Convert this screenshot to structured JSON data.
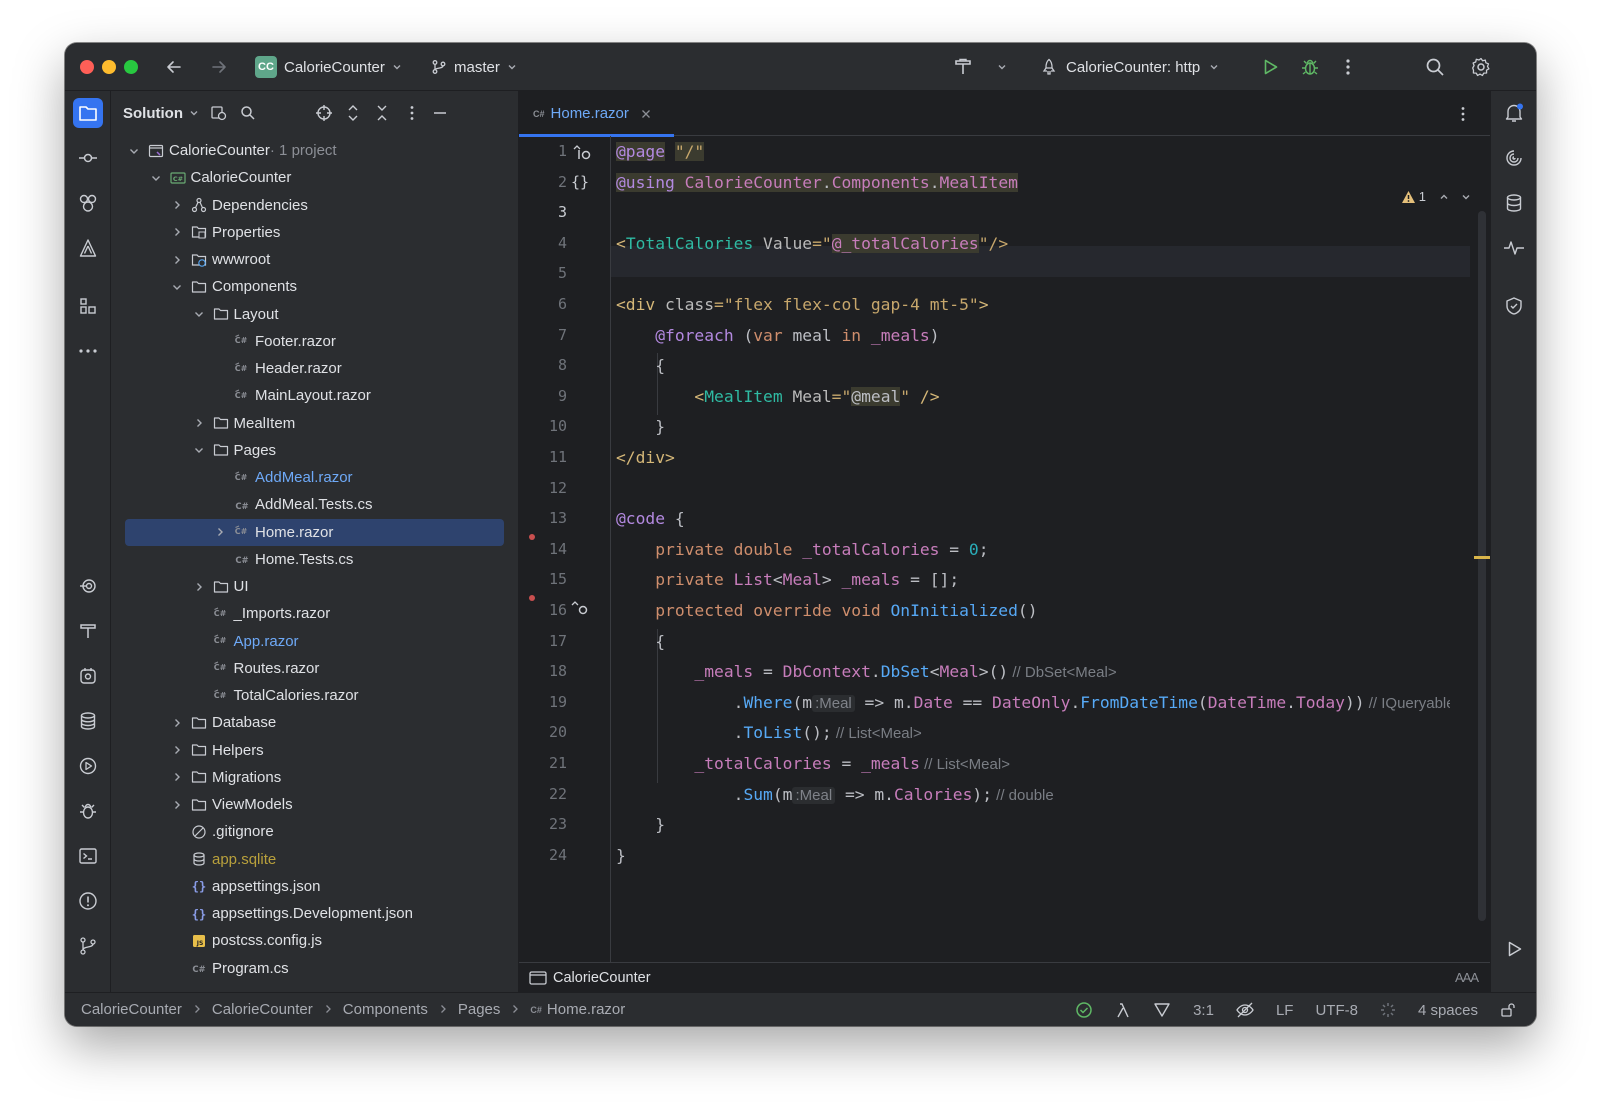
{
  "titlebar": {
    "project_badge": "CC",
    "project_name": "CalorieCounter",
    "branch": "master",
    "run_config": "CalorieCounter: http"
  },
  "sidebar": {
    "title": "Solution",
    "tree": [
      {
        "label": "CalorieCounter",
        "suffix": " · 1 project",
        "depth": 0,
        "expanded": true,
        "icon": "solution-icon"
      },
      {
        "label": "CalorieCounter",
        "depth": 1,
        "expanded": true,
        "icon": "csharp-project-icon"
      },
      {
        "label": "Dependencies",
        "depth": 2,
        "expanded": false,
        "icon": "dependencies-icon"
      },
      {
        "label": "Properties",
        "depth": 2,
        "expanded": false,
        "icon": "properties-folder-icon"
      },
      {
        "label": "wwwroot",
        "depth": 2,
        "expanded": false,
        "icon": "web-folder-icon"
      },
      {
        "label": "Components",
        "depth": 2,
        "expanded": true,
        "icon": "folder-icon"
      },
      {
        "label": "Layout",
        "depth": 3,
        "expanded": true,
        "icon": "folder-icon"
      },
      {
        "label": "Footer.razor",
        "depth": 4,
        "icon": "razor-file-icon"
      },
      {
        "label": "Header.razor",
        "depth": 4,
        "icon": "razor-file-icon"
      },
      {
        "label": "MainLayout.razor",
        "depth": 4,
        "icon": "razor-file-icon"
      },
      {
        "label": "MealItem",
        "depth": 3,
        "expanded": false,
        "icon": "folder-icon"
      },
      {
        "label": "Pages",
        "depth": 3,
        "expanded": true,
        "icon": "folder-icon"
      },
      {
        "label": "AddMeal.razor",
        "depth": 4,
        "icon": "razor-file-icon",
        "color": "#6ea9f7"
      },
      {
        "label": "AddMeal.Tests.cs",
        "depth": 4,
        "icon": "csharp-file-icon"
      },
      {
        "label": "Home.razor",
        "depth": 4,
        "expanded": false,
        "icon": "razor-file-icon",
        "selected": true
      },
      {
        "label": "Home.Tests.cs",
        "depth": 4,
        "icon": "csharp-file-icon"
      },
      {
        "label": "UI",
        "depth": 3,
        "expanded": false,
        "icon": "folder-icon"
      },
      {
        "label": "_Imports.razor",
        "depth": 3,
        "icon": "razor-file-icon"
      },
      {
        "label": "App.razor",
        "depth": 3,
        "icon": "razor-file-icon",
        "color": "#6ea9f7"
      },
      {
        "label": "Routes.razor",
        "depth": 3,
        "icon": "razor-file-icon"
      },
      {
        "label": "TotalCalories.razor",
        "depth": 3,
        "icon": "razor-file-icon"
      },
      {
        "label": "Database",
        "depth": 2,
        "expanded": false,
        "icon": "folder-icon"
      },
      {
        "label": "Helpers",
        "depth": 2,
        "expanded": false,
        "icon": "folder-icon"
      },
      {
        "label": "Migrations",
        "depth": 2,
        "expanded": false,
        "icon": "folder-icon"
      },
      {
        "label": "ViewModels",
        "depth": 2,
        "expanded": false,
        "icon": "folder-icon"
      },
      {
        "label": ".gitignore",
        "depth": 2,
        "icon": "gitignore-icon"
      },
      {
        "label": "app.sqlite",
        "depth": 2,
        "icon": "database-file-icon",
        "color": "#b8a03c"
      },
      {
        "label": "appsettings.json",
        "depth": 2,
        "icon": "json-file-icon"
      },
      {
        "label": "appsettings.Development.json",
        "depth": 2,
        "icon": "json-file-icon"
      },
      {
        "label": "postcss.config.js",
        "depth": 2,
        "icon": "js-file-icon"
      },
      {
        "label": "Program.cs",
        "depth": 2,
        "icon": "csharp-file-icon"
      }
    ]
  },
  "editor": {
    "tab_label": "Home.razor",
    "warning_count": "1",
    "footer_label": "CalorieCounter",
    "line_numbers": [
      "1",
      "2",
      "3",
      "4",
      "5",
      "6",
      "7",
      "8",
      "9",
      "10",
      "11",
      "12",
      "13",
      "14",
      "15",
      "16",
      "17",
      "18",
      "19",
      "20",
      "21",
      "22",
      "23",
      "24"
    ],
    "lines": [
      [
        {
          "t": "@page",
          "c": "dir razor-bg"
        },
        {
          "t": " ",
          "c": ""
        },
        {
          "t": "\"/\"",
          "c": "str razor-bg"
        }
      ],
      [
        {
          "t": "@using",
          "c": "dir razor-bg"
        },
        {
          "t": " CalorieCounter",
          "c": "razor-bg typ"
        },
        {
          "t": ".",
          "c": "razor-bg"
        },
        {
          "t": "Components",
          "c": "razor-bg typ"
        },
        {
          "t": ".",
          "c": "razor-bg"
        },
        {
          "t": "MealItem",
          "c": "razor-bg typ"
        }
      ],
      [],
      [
        {
          "t": "<",
          "c": "tag"
        },
        {
          "t": "TotalCalories",
          "c": "teal"
        },
        {
          "t": " Value",
          "c": "attr"
        },
        {
          "t": "=\"",
          "c": "str"
        },
        {
          "t": "@_totalCalories",
          "c": "razor-bg fld"
        },
        {
          "t": "\"/>",
          "c": "str"
        }
      ],
      [],
      [
        {
          "t": "<div",
          "c": "tag"
        },
        {
          "t": " class",
          "c": "attr"
        },
        {
          "t": "=\"flex flex-col gap-4 mt-5\"",
          "c": "str"
        },
        {
          "t": ">",
          "c": "tag"
        }
      ],
      [
        {
          "t": "    ",
          "c": ""
        },
        {
          "t": "@foreach",
          "c": "dir"
        },
        {
          "t": " (",
          "c": ""
        },
        {
          "t": "var",
          "c": "kw"
        },
        {
          "t": " meal ",
          "c": ""
        },
        {
          "t": "in",
          "c": "kw"
        },
        {
          "t": " _meals",
          "c": "fld"
        },
        {
          "t": ")",
          "c": ""
        }
      ],
      [
        {
          "t": "    {",
          "c": ""
        }
      ],
      [
        {
          "t": "        ",
          "c": ""
        },
        {
          "t": "<",
          "c": "tag"
        },
        {
          "t": "MealItem",
          "c": "teal"
        },
        {
          "t": " Meal",
          "c": "attr"
        },
        {
          "t": "=\"",
          "c": "str"
        },
        {
          "t": "@meal",
          "c": "razor-bg"
        },
        {
          "t": "\"",
          "c": "str"
        },
        {
          "t": " />",
          "c": "tag"
        }
      ],
      [
        {
          "t": "    }",
          "c": ""
        }
      ],
      [
        {
          "t": "</div>",
          "c": "tag"
        }
      ],
      [],
      [
        {
          "t": "@code",
          "c": "dir"
        },
        {
          "t": " {",
          "c": ""
        }
      ],
      [
        {
          "t": "    ",
          "c": ""
        },
        {
          "t": "private double",
          "c": "kw"
        },
        {
          "t": " _totalCalories",
          "c": "fld"
        },
        {
          "t": " = ",
          "c": ""
        },
        {
          "t": "0",
          "c": "num"
        },
        {
          "t": ";",
          "c": ""
        }
      ],
      [
        {
          "t": "    ",
          "c": ""
        },
        {
          "t": "private",
          "c": "kw"
        },
        {
          "t": " List",
          "c": "typ"
        },
        {
          "t": "<",
          "c": ""
        },
        {
          "t": "Meal",
          "c": "typ"
        },
        {
          "t": "> ",
          "c": ""
        },
        {
          "t": "_meals",
          "c": "fld"
        },
        {
          "t": " = [];",
          "c": ""
        }
      ],
      [
        {
          "t": "    ",
          "c": ""
        },
        {
          "t": "protected override void",
          "c": "kw"
        },
        {
          "t": " OnInitialized",
          "c": "fn"
        },
        {
          "t": "()",
          "c": ""
        }
      ],
      [
        {
          "t": "    {",
          "c": ""
        }
      ],
      [
        {
          "t": "        ",
          "c": ""
        },
        {
          "t": "_meals",
          "c": "fld"
        },
        {
          "t": " = ",
          "c": ""
        },
        {
          "t": "DbContext",
          "c": "typ"
        },
        {
          "t": ".",
          "c": ""
        },
        {
          "t": "DbSet",
          "c": "mth"
        },
        {
          "t": "<",
          "c": ""
        },
        {
          "t": "Meal",
          "c": "typ"
        },
        {
          "t": ">()",
          "c": ""
        },
        {
          "t": " // DbSet<Meal>",
          "c": "cmt"
        }
      ],
      [
        {
          "t": "            .",
          "c": ""
        },
        {
          "t": "Where",
          "c": "mth"
        },
        {
          "t": "(m",
          "c": ""
        },
        {
          "t": ":Meal",
          "c": "hint"
        },
        {
          "t": " => m.",
          "c": ""
        },
        {
          "t": "Date",
          "c": "fld"
        },
        {
          "t": " == ",
          "c": ""
        },
        {
          "t": "DateOnly",
          "c": "typ"
        },
        {
          "t": ".",
          "c": ""
        },
        {
          "t": "FromDateTime",
          "c": "mth"
        },
        {
          "t": "(",
          "c": ""
        },
        {
          "t": "DateTime",
          "c": "typ"
        },
        {
          "t": ".",
          "c": ""
        },
        {
          "t": "Today",
          "c": "fld"
        },
        {
          "t": "))",
          "c": ""
        },
        {
          "t": " // IQueryable<Meal>",
          "c": "cmt"
        }
      ],
      [
        {
          "t": "            .",
          "c": ""
        },
        {
          "t": "ToList",
          "c": "mth"
        },
        {
          "t": "();",
          "c": ""
        },
        {
          "t": " // List<Meal>",
          "c": "cmt"
        }
      ],
      [
        {
          "t": "        ",
          "c": ""
        },
        {
          "t": "_totalCalories",
          "c": "fld"
        },
        {
          "t": " = ",
          "c": ""
        },
        {
          "t": "_meals",
          "c": "fld"
        },
        {
          "t": " // List<Meal>",
          "c": "cmt"
        }
      ],
      [
        {
          "t": "            .",
          "c": ""
        },
        {
          "t": "Sum",
          "c": "mth"
        },
        {
          "t": "(m",
          "c": ""
        },
        {
          "t": ":Meal",
          "c": "hint"
        },
        {
          "t": " => m.",
          "c": ""
        },
        {
          "t": "Calories",
          "c": "fld"
        },
        {
          "t": ");",
          "c": ""
        },
        {
          "t": " // double",
          "c": "cmt"
        }
      ],
      [
        {
          "t": "    }",
          "c": ""
        }
      ],
      [
        {
          "t": "}",
          "c": ""
        }
      ]
    ]
  },
  "statusbar": {
    "breadcrumbs": [
      "CalorieCounter",
      "CalorieCounter",
      "Components",
      "Pages",
      "Home.razor"
    ],
    "caret": "3:1",
    "line_ending": "LF",
    "encoding": "UTF-8",
    "indent": "4 spaces"
  },
  "colors": {
    "accent": "#3574f0",
    "selection": "#2e436e",
    "window_bg": "#1e1f22",
    "panel_bg": "#2b2d30"
  }
}
